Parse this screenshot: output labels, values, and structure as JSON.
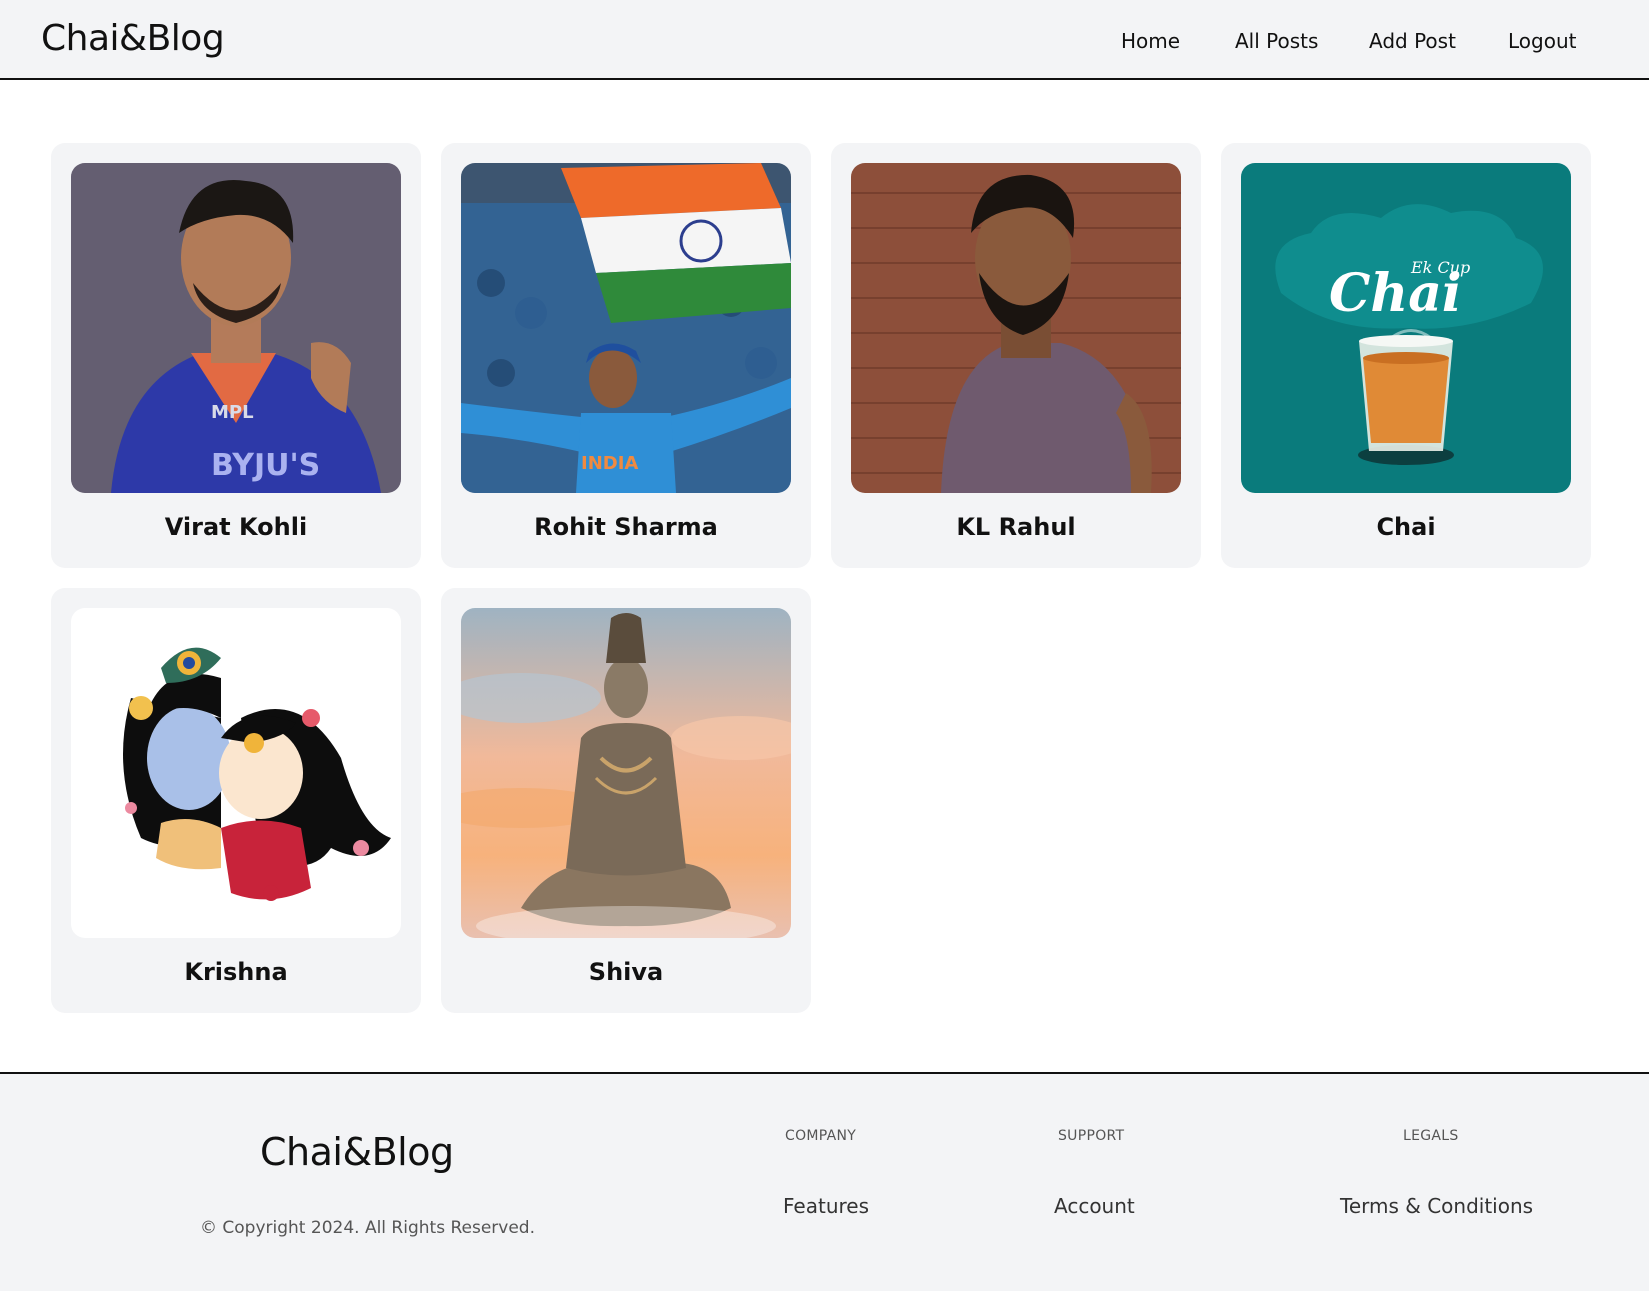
{
  "header": {
    "logo": "Chai&Blog",
    "nav": [
      "Home",
      "All Posts",
      "Add Post",
      "Logout"
    ]
  },
  "posts": [
    {
      "title": "Virat Kohli"
    },
    {
      "title": "Rohit Sharma"
    },
    {
      "title": "KL Rahul"
    },
    {
      "title": "Chai"
    },
    {
      "title": "Krishna"
    },
    {
      "title": "Shiva"
    }
  ],
  "post_images": {
    "chai_caption_small": "Ek Cup",
    "chai_caption_big": "Chai",
    "rohit_jersey_text": "INDIA",
    "virat_jersey_logo": "MPL",
    "virat_jersey_sponsor": "BYJU'S"
  },
  "footer": {
    "logo": "Chai&Blog",
    "copyright": "© Copyright 2024. All Rights Reserved.",
    "columns": [
      {
        "heading": "Company",
        "link": "Features"
      },
      {
        "heading": "Support",
        "link": "Account"
      },
      {
        "heading": "Legals",
        "link": "Terms & Conditions"
      }
    ]
  }
}
